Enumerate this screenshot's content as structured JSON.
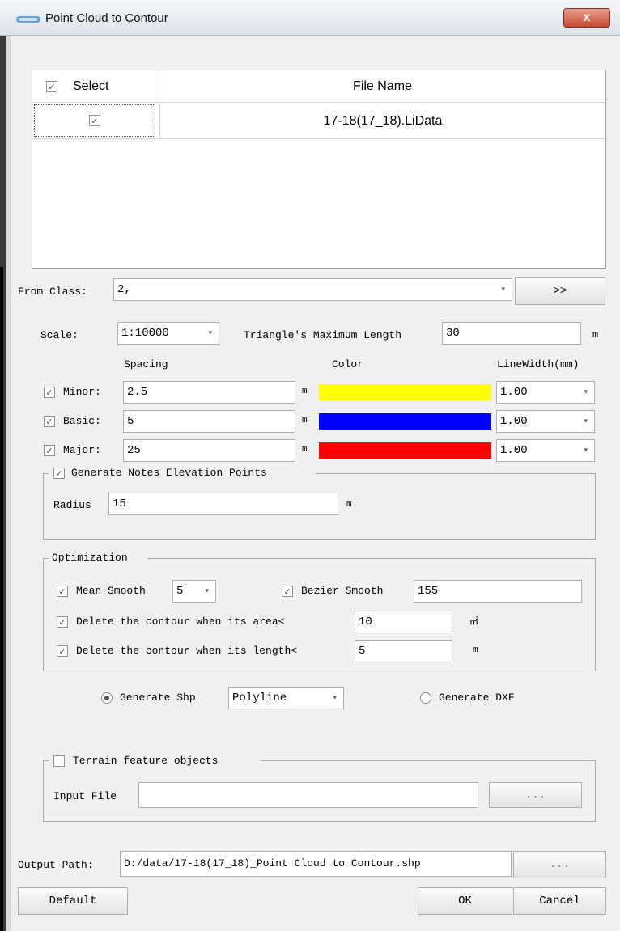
{
  "window": {
    "title": "Point Cloud to Contour",
    "close_symbol": "x"
  },
  "file_grid": {
    "headers": {
      "select": "Select",
      "file_name": "File Name"
    },
    "rows": [
      {
        "file_name": "17-18(17_18).LiData",
        "checked": true
      }
    ]
  },
  "from_class": {
    "label": "From Class:",
    "value": "2,",
    "button": ">>"
  },
  "scale": {
    "label": "Scale:",
    "value": "1:10000",
    "max_len_label": "Triangle's Maximum Length",
    "max_len_value": "30",
    "unit": "m"
  },
  "columns": {
    "spacing": "Spacing",
    "color": "Color",
    "linewidth": "LineWidth(mm)"
  },
  "contours": [
    {
      "label": "Minor:",
      "spacing": "2.5",
      "unit": "m",
      "color": "#ffff00",
      "width": "1.00"
    },
    {
      "label": "Basic:",
      "spacing": "5",
      "unit": "m",
      "color": "#0000ff",
      "width": "1.00"
    },
    {
      "label": "Major:",
      "spacing": "25",
      "unit": "m",
      "color": "#ff0000",
      "width": "1.00"
    }
  ],
  "notes": {
    "title": "Generate Notes Elevation Points",
    "radius_label": "Radius",
    "radius_value": "15",
    "unit": "m"
  },
  "optimization": {
    "title": "Optimization",
    "mean_label": "Mean Smooth",
    "mean_value": "5",
    "bezier_label": "Bezier Smooth",
    "bezier_value": "155",
    "area_label": "Delete the contour when its area<",
    "area_value": "10",
    "area_unit": "㎡",
    "length_label": "Delete the contour when its length<",
    "length_value": "5",
    "length_unit": "m"
  },
  "output_type": {
    "shp_label": "Generate Shp",
    "shp_type": "Polyline",
    "dxf_label": "Generate DXF"
  },
  "terrain": {
    "title": "Terrain feature objects",
    "input_label": "Input File",
    "input_value": "",
    "browse": "..."
  },
  "output": {
    "label": "Output Path:",
    "value": "D:/data/17-18(17_18)_Point Cloud to Contour.shp",
    "browse": "..."
  },
  "buttons": {
    "default": "Default",
    "ok": "OK",
    "cancel": "Cancel"
  },
  "icons": {
    "check": "✓",
    "dropdown": "▾"
  }
}
